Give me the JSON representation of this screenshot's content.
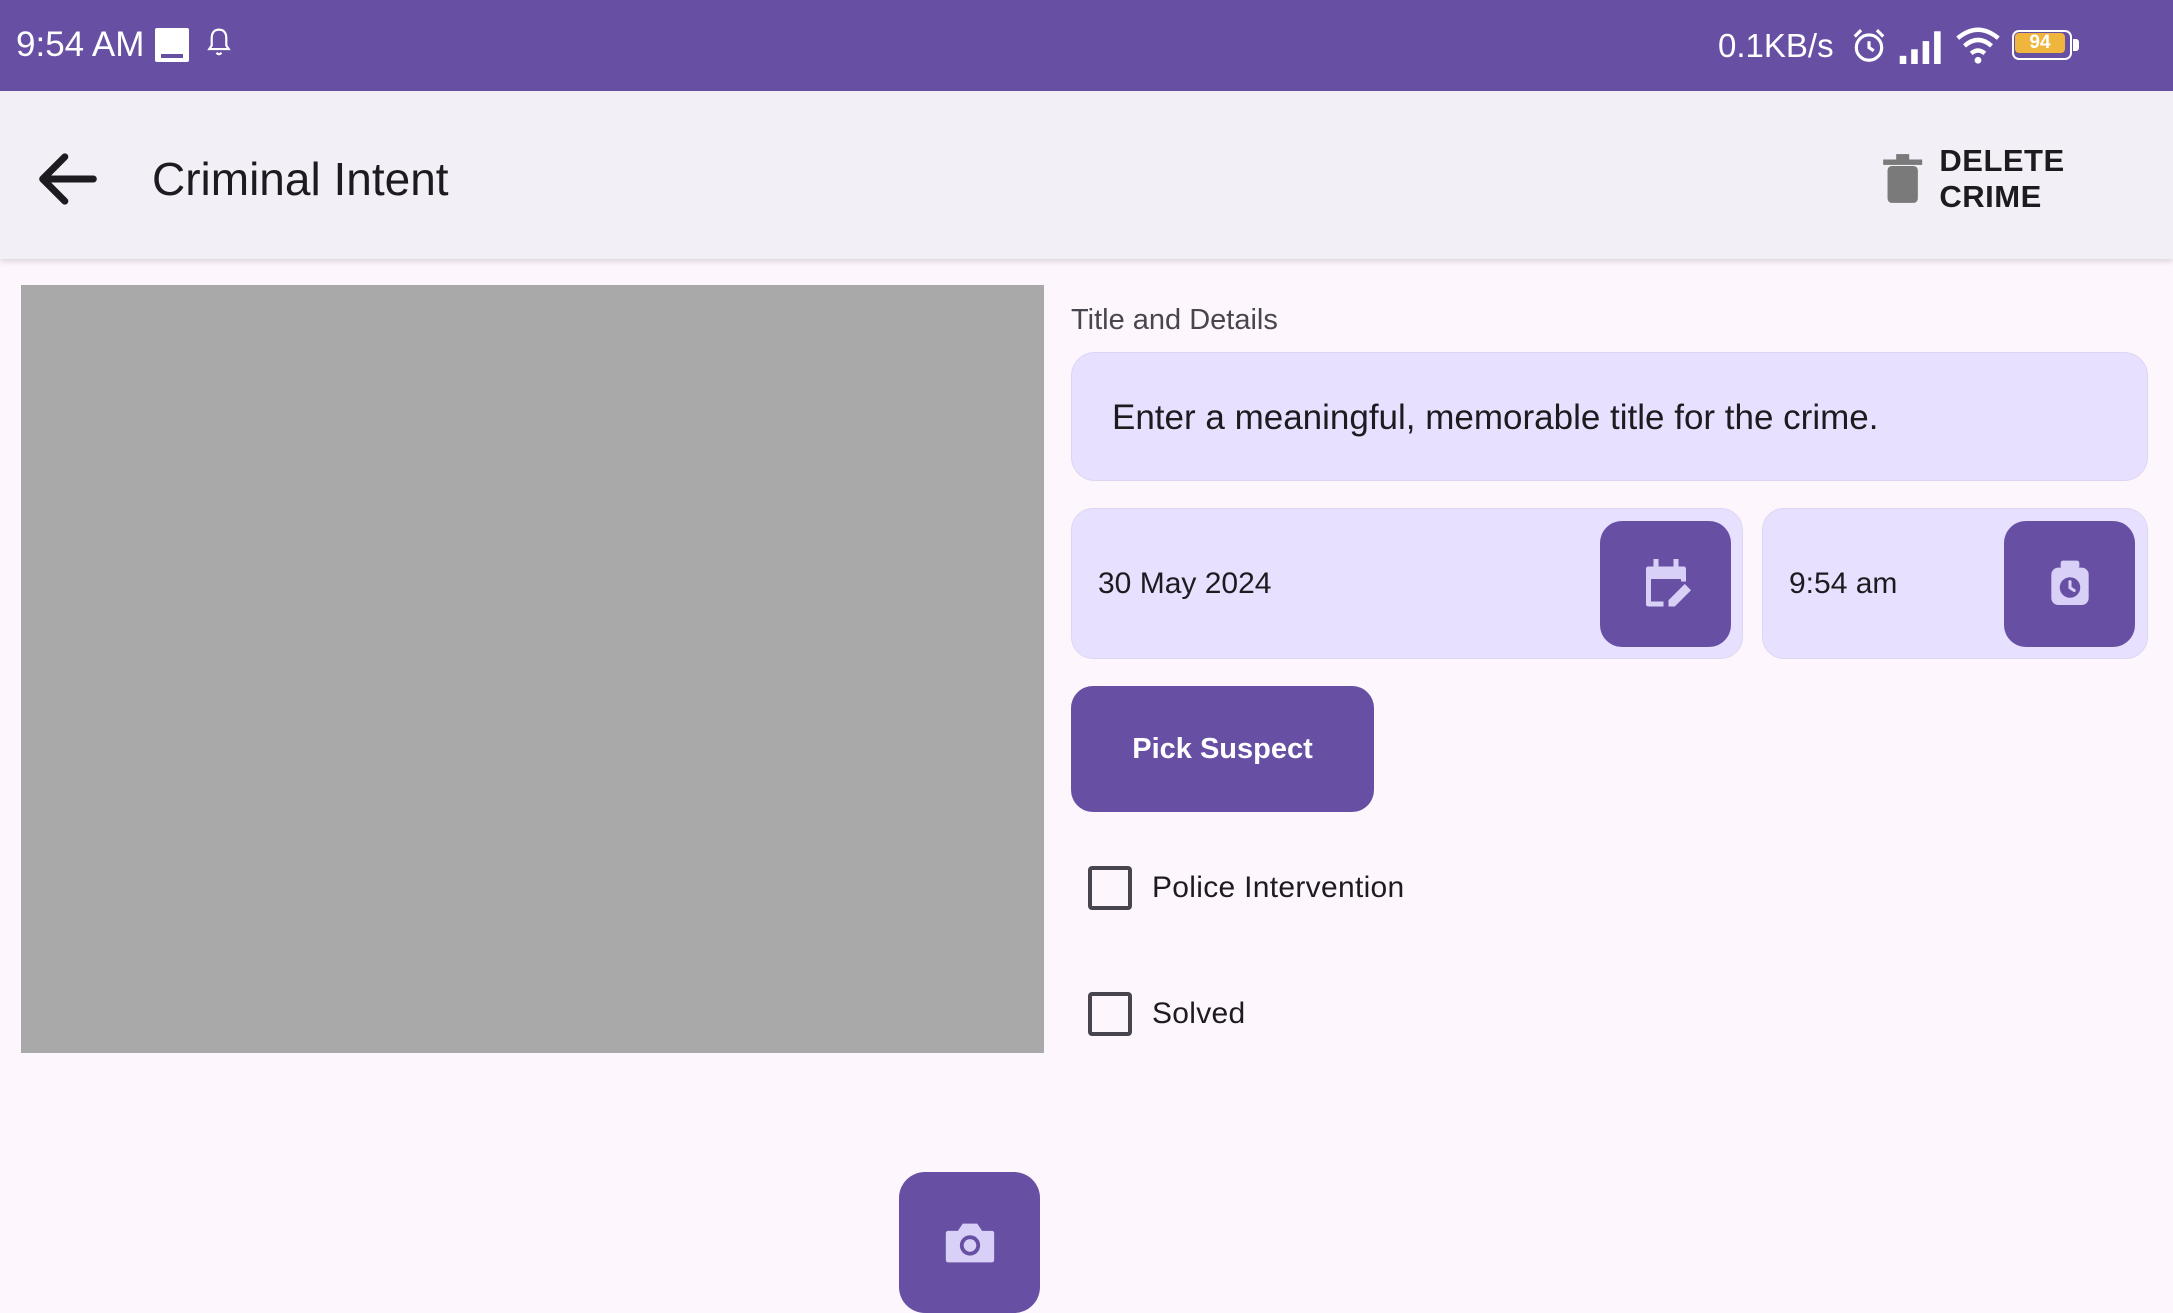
{
  "status_bar": {
    "time": "9:54 AM",
    "net_speed": "0.1KB/s",
    "battery_level": "94",
    "icons": [
      "notification-square-icon",
      "bell-icon",
      "alarm-icon",
      "signal-icon",
      "wifi-icon",
      "battery-icon"
    ]
  },
  "app_bar": {
    "title": "Criminal Intent",
    "back_icon": "arrow-back-icon",
    "delete_label": "DELETE CRIME",
    "delete_icon": "trash-icon"
  },
  "photo": {
    "camera_icon": "camera-icon"
  },
  "form": {
    "section_label": "Title and Details",
    "title_placeholder": "Enter a meaningful, memorable title for the crime.",
    "date_value": "30 May 2024",
    "date_icon": "calendar-edit-icon",
    "time_value": "9:54 am",
    "time_icon": "clock-icon",
    "suspect_button": "Pick Suspect",
    "checkboxes": [
      {
        "label": "Police Intervention",
        "checked": false
      },
      {
        "label": "Solved",
        "checked": false
      }
    ]
  },
  "colors": {
    "primary": "#6750a4",
    "field_background": "#e7e0fe",
    "app_bar_background": "#f3eff7",
    "page_background": "#fdf7fd",
    "photo_placeholder": "#a9a9a9"
  }
}
